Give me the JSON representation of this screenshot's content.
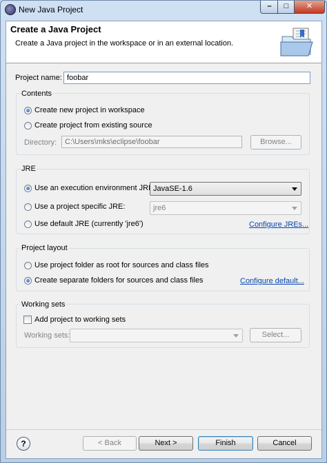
{
  "window": {
    "title": "New Java Project"
  },
  "banner": {
    "title": "Create a Java Project",
    "description": "Create a Java project in the workspace or in an external location."
  },
  "project_name": {
    "label": "Project name:",
    "value": "foobar"
  },
  "contents": {
    "title": "Contents",
    "option_workspace": "Create new project in workspace",
    "option_existing": "Create project from existing source",
    "directory_label": "Directory:",
    "directory_value": "C:\\Users\\mks\\eclipse\\foobar",
    "browse_label": "Browse...",
    "selected": "workspace"
  },
  "jre": {
    "title": "JRE",
    "option_env": "Use an execution environment JRE:",
    "env_value": "JavaSE-1.6",
    "option_specific": "Use a project specific JRE:",
    "specific_value": "jre6",
    "option_default": "Use default JRE (currently 'jre6')",
    "configure_link": "Configure JREs...",
    "selected": "env"
  },
  "layout": {
    "title": "Project layout",
    "option_root": "Use project folder as root for sources and class files",
    "option_separate": "Create separate folders for sources and class files",
    "configure_link": "Configure default...",
    "selected": "separate"
  },
  "working_sets": {
    "title": "Working sets",
    "checkbox_label": "Add project to working sets",
    "checked": false,
    "field_label": "Working sets:",
    "field_value": "",
    "select_label": "Select..."
  },
  "footer": {
    "help": "?",
    "back": "< Back",
    "next": "Next >",
    "finish": "Finish",
    "cancel": "Cancel"
  },
  "colors": {
    "link": "#0645ad",
    "selection_accent": "#1d4f9c"
  }
}
